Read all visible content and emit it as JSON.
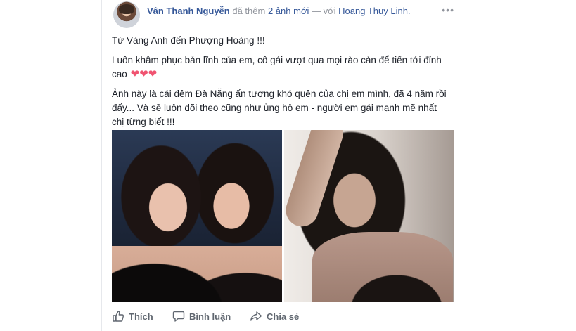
{
  "post": {
    "author": "Vân Thanh Nguyễn",
    "action_text": "đã thêm",
    "photo_count_link": "2 ảnh mới",
    "dash": "—",
    "with_text": "với",
    "tagged_person": "Hoang Thuy Linh.",
    "more_label": "•••",
    "paragraphs": {
      "p1": "Từ Vàng Anh đến Phượng Hoàng !!!",
      "p2": "Luôn khâm phục bản lĩnh của em, cô gái vượt qua mọi rào cản để tiến tới đỉnh cao",
      "p2_hearts": "❤❤❤",
      "p3": "Ảnh này là cái đêm Đà Nẵng ấn tượng khó quên của chị em mình, đã 4 năm rồi đấy... Và sẽ luôn dõi theo cũng như ủng hộ em - người em gái mạnh mẽ nhất chị từng biết !!!"
    }
  },
  "actions": {
    "like_label": "Thích",
    "comment_label": "Bình luận",
    "share_label": "Chia sẻ"
  },
  "icons": {
    "avatar": "profile-photo",
    "more": "ellipsis-icon",
    "like": "thumbs-up-icon",
    "comment": "comment-bubble-icon",
    "share": "share-arrow-icon"
  },
  "colors": {
    "link": "#365899",
    "meta": "#90949c",
    "text": "#1d2129",
    "action": "#606770",
    "heart": "#f05471"
  }
}
